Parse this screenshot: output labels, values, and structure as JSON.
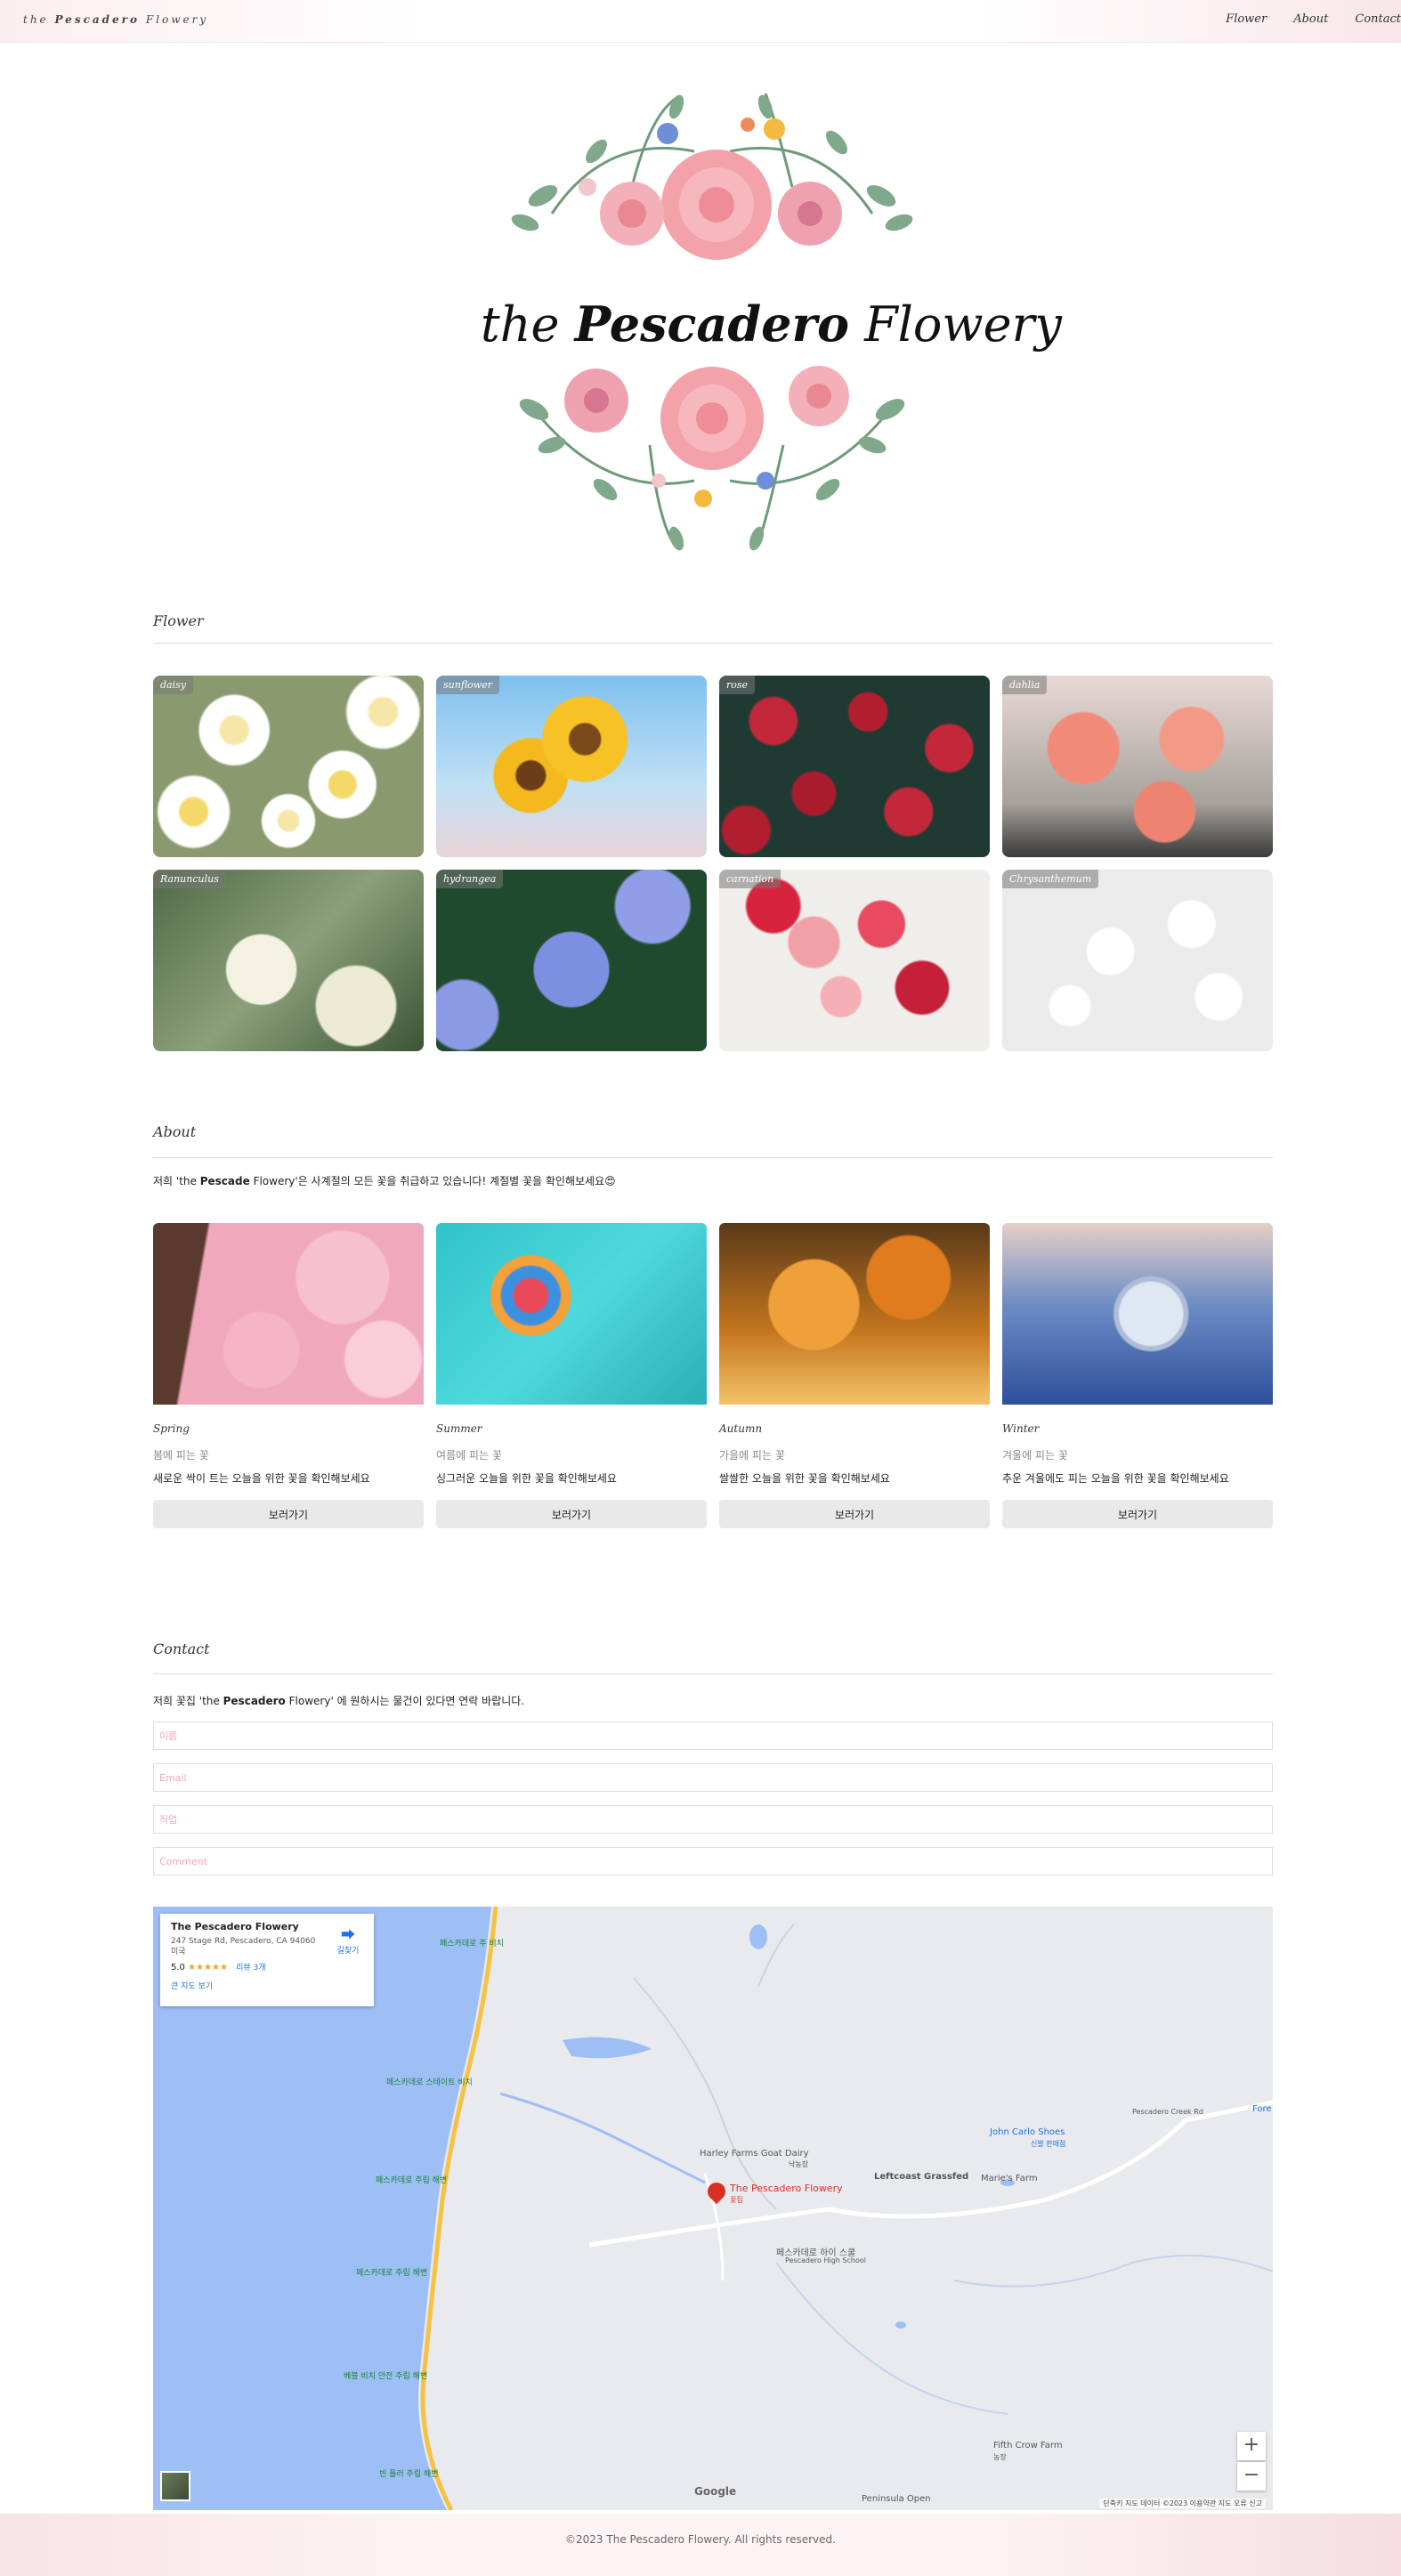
{
  "nav": {
    "brand_prefix": "the",
    "brand_bold": "Pescadero",
    "brand_suffix": "Flowery",
    "links": [
      "Flower",
      "About",
      "Contact"
    ]
  },
  "hero": {
    "title_prefix": "the",
    "title_bold": "Pescadero",
    "title_suffix": "Flowery"
  },
  "flower_section": {
    "title": "Flower",
    "cards": [
      "daisy",
      "sunflower",
      "rose",
      "dahlia",
      "Ranunculus",
      "hydrangea",
      "carnation",
      "Chrysanthemum"
    ]
  },
  "about_section": {
    "title": "About",
    "intro_prefix": "저희 'the",
    "intro_bold": "Pescade",
    "intro_suffix": "Flowery'은 사계절의 모든 꽃을 취급하고 있습니다! 계절별 꽃을 확인해보세요😍",
    "seasons": [
      {
        "name": "Spring",
        "sub": "봄에 피는 꽃",
        "desc": "새로운 싹이 트는 오늘을 위한 꽃을 확인해보세요",
        "button": "보러가기"
      },
      {
        "name": "Summer",
        "sub": "여름에 피는 꽃",
        "desc": "싱그러운 오늘을 위한 꽃을 확인해보세요",
        "button": "보러가기"
      },
      {
        "name": "Autumn",
        "sub": "가을에 피는 꽃",
        "desc": "쌀쌀한 오늘을 위한 꽃을 확인해보세요",
        "button": "보러가기"
      },
      {
        "name": "Winter",
        "sub": "겨울에 피는 꽃",
        "desc": "추운 겨울에도 피는 오늘을 위한 꽃을 확인해보세요",
        "button": "보러가기"
      }
    ]
  },
  "contact_section": {
    "title": "Contact",
    "intro_prefix": "저희 꽃집 'the",
    "intro_bold": "Pescadero",
    "intro_suffix": "Flowery' 에 원하시는 물건이 있다면 연락 바랍니다.",
    "placeholders": [
      "이름",
      "Email",
      "직업",
      "Comment"
    ]
  },
  "map": {
    "place_name": "The Pescadero Flowery",
    "address_line1": "247 Stage Rd, Pescadero, CA 94060",
    "address_line2": "미국",
    "rating": "5.0",
    "stars": "★★★★★",
    "reviews": "리뷰 3개",
    "directions": "길찾기",
    "larger_map": "큰 지도 보기",
    "labels": {
      "flowery": "The Pescadero Flowery",
      "flowery_sub": "꽃집",
      "goat_dairy": "Harley Farms Goat Dairy",
      "goat_dairy_sub": "낙농장",
      "leftcoast": "Leftcoast Grassfed",
      "john_carlo": "John Carlo Shoes",
      "john_carlo_sub": "신발 판매점",
      "maries": "Marie's Farm",
      "high_school": "페스카데로 하이 스쿨",
      "high_school_en": "Pescadero High School",
      "fifth_crow": "Fifth Crow Farm",
      "fifth_crow_sub": "농장",
      "peninsula": "Peninsula Open",
      "creek_rd": "Pescadero Creek Rd",
      "beach1": "페스카데로 주 비치",
      "beach2": "페스카데로 스테이트 비치",
      "beach3": "페스카데로 주립 해변",
      "beach4": "페스카데로 주립 해변",
      "beach5": "베블 비치 안전 주립 해변",
      "beach6": "빈 플러 주립 해변",
      "forest": "Fore"
    },
    "zoom_in": "+",
    "zoom_out": "−",
    "attribution": "단축키   지도 데이터 ©2023   이용약관   지도 오류 신고",
    "google": "Google"
  },
  "footer": {
    "text": "©2023 The Pescadero Flowery. All rights reserved."
  },
  "colors": {
    "placeholder": "#f1a9b4",
    "map_water": "#9dbff5",
    "map_land": "#e9eaee",
    "map_road": "#ffffff",
    "highway": "#f6c242",
    "pin": "#d93025"
  }
}
